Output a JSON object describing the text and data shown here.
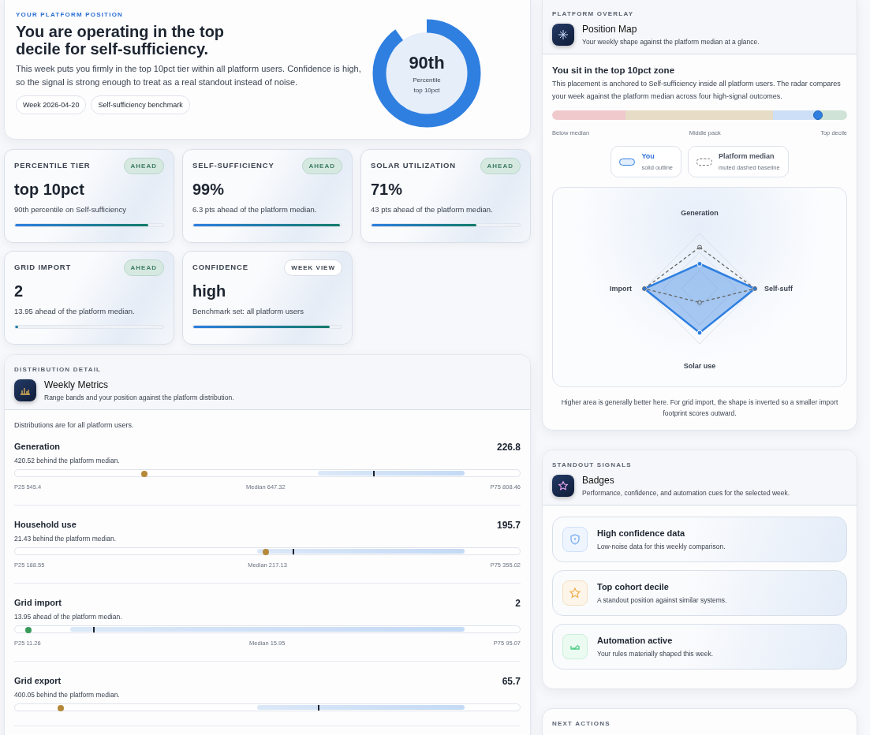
{
  "hero": {
    "eyebrow": "YOUR PLATFORM POSITION",
    "title": "You are operating in the top decile for self-sufficiency.",
    "description": "This week puts you firmly in the top 10pct tier within all platform users. Confidence is high, so the signal is strong enough to treat as a real standout instead of noise.",
    "chips": [
      "Week 2026-04-20",
      "Self-sufficiency benchmark"
    ],
    "donut": {
      "value": "90th",
      "caption": "Percentile",
      "tier": "top 10pct",
      "level": 0.9
    }
  },
  "metrics": [
    {
      "label": "PERCENTILE TIER",
      "tag": "AHEAD",
      "kind": "status",
      "value": "top 10pct",
      "note": "90th percentile on Self-sufficiency",
      "level": 0.9
    },
    {
      "label": "SELF-SUFFICIENCY",
      "tag": "AHEAD",
      "kind": "status",
      "value": "99%",
      "note": "6.3 pts ahead of the platform median.",
      "level": 0.99
    },
    {
      "label": "SOLAR UTILIZATION",
      "tag": "AHEAD",
      "kind": "status",
      "value": "71%",
      "note": "43 pts ahead of the platform median.",
      "level": 0.71
    },
    {
      "label": "GRID IMPORT",
      "tag": "AHEAD",
      "kind": "status",
      "value": "2",
      "note": "13.95 ahead of the platform median.",
      "level": 0.02
    },
    {
      "label": "CONFIDENCE",
      "tag": "WEEK VIEW",
      "kind": "view",
      "value": "high",
      "note": "Benchmark set: all platform users",
      "level": 0.92
    }
  ],
  "distribution": {
    "eyebrow": "DISTRIBUTION DETAIL",
    "title": "Weekly Metrics",
    "subtitle": "Range bands and your position against the platform distribution.",
    "note": "Distributions are for all platform users.",
    "rows": [
      {
        "name": "Generation",
        "value": "226.8",
        "delta": "420.52 behind the platform median.",
        "p25": "P25 545.4",
        "median": "Median 647.32",
        "p75": "P75 808.46",
        "level": 0.25,
        "color": "#b5893a"
      },
      {
        "name": "Household use",
        "value": "195.7",
        "delta": "21.43 behind the platform median.",
        "p25": "P25 188.55",
        "median": "Median 217.13",
        "p75": "P75 355.02",
        "level": 0.49,
        "color": "#b5893a"
      },
      {
        "name": "Grid import",
        "value": "2",
        "delta": "13.95 ahead of the platform median.",
        "p25": "P25 11.26",
        "median": "Median 15.95",
        "p75": "P75 95.07",
        "level": 0.02,
        "color": "#3a9a5b"
      },
      {
        "name": "Grid export",
        "value": "65.7",
        "delta": "400.05 behind the platform median.",
        "level": 0.085,
        "color": "#b5893a"
      }
    ]
  },
  "overlay": {
    "eyebrow": "PLATFORM OVERLAY",
    "title": "Position Map",
    "subtitle": "Your weekly shape against the platform median at a glance.",
    "zone_title": "You sit in the top 10pct zone",
    "zone_text": "This placement is anchored to Self-sufficiency inside all platform users. The radar compares your week against the platform median across four high-signal outcomes.",
    "level": 0.9,
    "zone_labels": [
      "Below median",
      "Middle pack",
      "Top decile"
    ],
    "legend": [
      {
        "kind": "you",
        "title": "You",
        "text": "solid outline"
      },
      {
        "kind": "median",
        "title": "Platform median",
        "text": "muted dashed baseline"
      }
    ],
    "axes": [
      "Generation",
      "Self-suff",
      "Solar use",
      "Import"
    ],
    "footnote": "Higher area is generally better here. For grid import, the shape is inverted so a smaller import footprint scores outward."
  },
  "badges": {
    "eyebrow": "STANDOUT SIGNALS",
    "title": "Badges",
    "subtitle": "Performance, confidence, and automation cues for the selected week.",
    "items": [
      {
        "kind": "shield",
        "title": "High confidence data",
        "text": "Low-noise data for this weekly comparison."
      },
      {
        "kind": "star",
        "title": "Top cohort decile",
        "text": "A standout position against similar systems."
      },
      {
        "kind": "check",
        "title": "Automation active",
        "text": "Your rules materially shaped this week."
      }
    ]
  },
  "next": {
    "eyebrow": "NEXT ACTIONS"
  }
}
